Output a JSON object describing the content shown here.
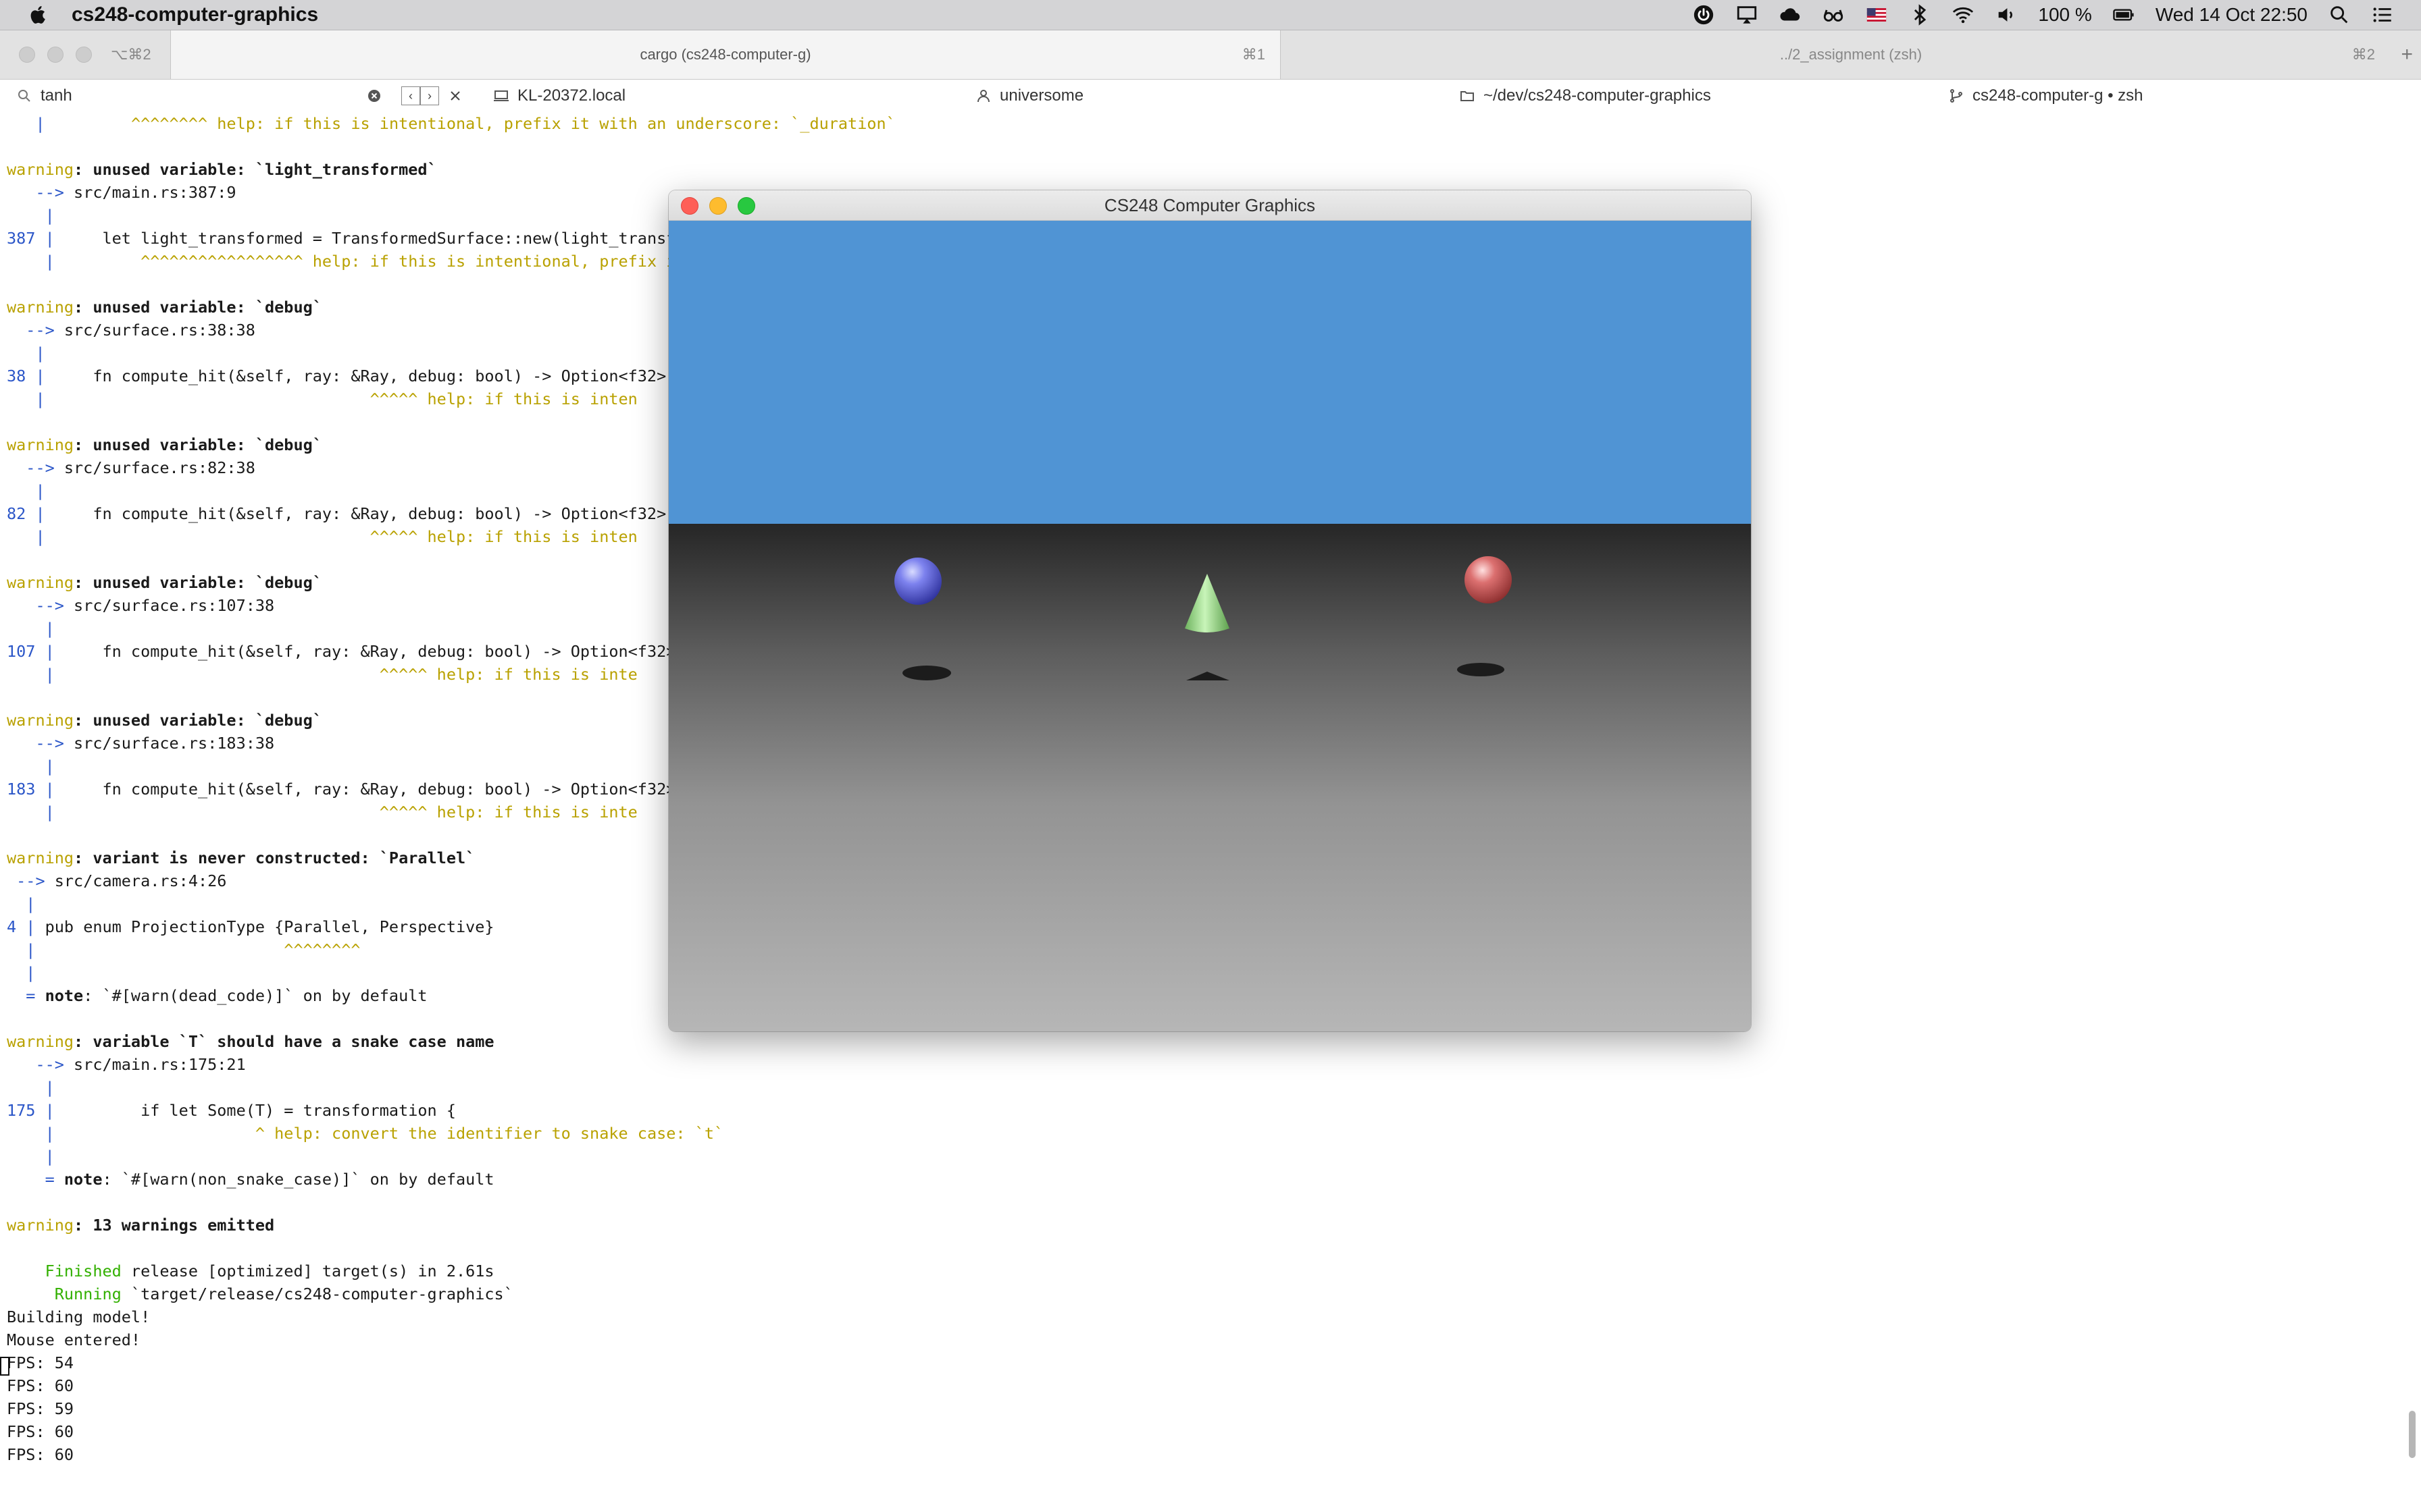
{
  "menubar": {
    "app_name": "cs248-computer-graphics",
    "battery": "100 %",
    "datetime": "Wed 14 Oct  22:50"
  },
  "tabs": {
    "left_shortcut": "⌥⌘2",
    "active_title": "cargo (cs248-computer-g)",
    "active_shortcut": "⌘1",
    "right_title": "../2_assignment (zsh)",
    "right_shortcut": "⌘2",
    "plus": "+"
  },
  "statusbar": {
    "search_value": "tanh",
    "host": "KL-20372.local",
    "user": "universome",
    "path": "~/dev/cs248-computer-graphics",
    "job": "cs248-computer-g • zsh"
  },
  "graphics_window": {
    "title": "CS248 Computer Graphics",
    "colors": {
      "sky": "#5094d4",
      "sphere_blue": "#6f74e6",
      "sphere_red": "#d46666",
      "cone": "#8ed67e"
    }
  },
  "terminal": {
    "lines": [
      [
        [
          "   |         ",
          "blue"
        ],
        [
          "^^^^^^^^ help: if this is intentional, prefix it with an underscore: `_duration`",
          "help"
        ]
      ],
      [],
      [
        [
          "warning",
          "warn"
        ],
        [
          ": unused variable: `light_transformed`",
          "bold"
        ]
      ],
      [
        [
          "   --> ",
          "blue"
        ],
        [
          "src/main.rs:387:9",
          ""
        ]
      ],
      [
        [
          "    |",
          "blue"
        ]
      ],
      [
        [
          "387 |",
          "blue"
        ],
        [
          "     let light_transformed = TransformedSurface::new(light_transf",
          ""
        ]
      ],
      [
        [
          "    |",
          "blue"
        ],
        [
          "         ^^^^^^^^^^^^^^^^^ help: if this is intentional, prefix i",
          "help"
        ]
      ],
      [],
      [
        [
          "warning",
          "warn"
        ],
        [
          ": unused variable: `debug`",
          "bold"
        ]
      ],
      [
        [
          "  --> ",
          "blue"
        ],
        [
          "src/surface.rs:38:38",
          ""
        ]
      ],
      [
        [
          "   |",
          "blue"
        ]
      ],
      [
        [
          "38 |",
          "blue"
        ],
        [
          "     fn compute_hit(&self, ray: &Ray, debug: bool) -> Option<f32>",
          ""
        ]
      ],
      [
        [
          "   |",
          "blue"
        ],
        [
          "                                  ^^^^^ help: if this is inten",
          "help"
        ]
      ],
      [],
      [
        [
          "warning",
          "warn"
        ],
        [
          ": unused variable: `debug`",
          "bold"
        ]
      ],
      [
        [
          "  --> ",
          "blue"
        ],
        [
          "src/surface.rs:82:38",
          ""
        ]
      ],
      [
        [
          "   |",
          "blue"
        ]
      ],
      [
        [
          "82 |",
          "blue"
        ],
        [
          "     fn compute_hit(&self, ray: &Ray, debug: bool) -> Option<f32>",
          ""
        ]
      ],
      [
        [
          "   |",
          "blue"
        ],
        [
          "                                  ^^^^^ help: if this is inten",
          "help"
        ]
      ],
      [],
      [
        [
          "warning",
          "warn"
        ],
        [
          ": unused variable: `debug`",
          "bold"
        ]
      ],
      [
        [
          "   --> ",
          "blue"
        ],
        [
          "src/surface.rs:107:38",
          ""
        ]
      ],
      [
        [
          "    |",
          "blue"
        ]
      ],
      [
        [
          "107 |",
          "blue"
        ],
        [
          "     fn compute_hit(&self, ray: &Ray, debug: bool) -> Option<f32>",
          ""
        ]
      ],
      [
        [
          "    |",
          "blue"
        ],
        [
          "                                  ^^^^^ help: if this is inte",
          "help"
        ]
      ],
      [],
      [
        [
          "warning",
          "warn"
        ],
        [
          ": unused variable: `debug`",
          "bold"
        ]
      ],
      [
        [
          "   --> ",
          "blue"
        ],
        [
          "src/surface.rs:183:38",
          ""
        ]
      ],
      [
        [
          "    |",
          "blue"
        ]
      ],
      [
        [
          "183 |",
          "blue"
        ],
        [
          "     fn compute_hit(&self, ray: &Ray, debug: bool) -> Option<f32>",
          ""
        ]
      ],
      [
        [
          "    |",
          "blue"
        ],
        [
          "                                  ^^^^^ help: if this is inte",
          "help"
        ]
      ],
      [],
      [
        [
          "warning",
          "warn"
        ],
        [
          ": variant is never constructed: `Parallel`",
          "bold"
        ]
      ],
      [
        [
          " --> ",
          "blue"
        ],
        [
          "src/camera.rs:4:26",
          ""
        ]
      ],
      [
        [
          "  |",
          "blue"
        ]
      ],
      [
        [
          "4 |",
          "blue"
        ],
        [
          " pub enum ProjectionType {Parallel, Perspective}",
          ""
        ]
      ],
      [
        [
          "  |",
          "blue"
        ],
        [
          "                          ^^^^^^^^",
          "help"
        ]
      ],
      [
        [
          "  |",
          "blue"
        ]
      ],
      [
        [
          "  = ",
          "blue"
        ],
        [
          "note",
          "bold"
        ],
        [
          ": `#[warn(dead_code)]` on by default",
          ""
        ]
      ],
      [],
      [
        [
          "warning",
          "warn"
        ],
        [
          ": variable `T` should have a snake case name",
          "bold"
        ]
      ],
      [
        [
          "   --> ",
          "blue"
        ],
        [
          "src/main.rs:175:21",
          ""
        ]
      ],
      [
        [
          "    |",
          "blue"
        ]
      ],
      [
        [
          "175 |",
          "blue"
        ],
        [
          "         if let Some(T) = transformation {",
          ""
        ]
      ],
      [
        [
          "    |",
          "blue"
        ],
        [
          "                     ^ help: convert the identifier to snake case: `t`",
          "help"
        ]
      ],
      [
        [
          "    |",
          "blue"
        ]
      ],
      [
        [
          "    = ",
          "blue"
        ],
        [
          "note",
          "bold"
        ],
        [
          ": `#[warn(non_snake_case)]` on by default",
          ""
        ]
      ],
      [],
      [
        [
          "warning",
          "warn"
        ],
        [
          ": 13 warnings emitted",
          "bold"
        ]
      ],
      [],
      [
        [
          "    Finished",
          "green"
        ],
        [
          " release [optimized] target(s) in 2.61s",
          ""
        ]
      ],
      [
        [
          "     Running",
          "green"
        ],
        [
          " `target/release/cs248-computer-graphics`",
          ""
        ]
      ],
      [
        [
          "Building model!",
          ""
        ]
      ],
      [
        [
          "Mouse entered!",
          ""
        ]
      ],
      [
        [
          "FPS: 54",
          ""
        ]
      ],
      [
        [
          "FPS: 60",
          ""
        ]
      ],
      [
        [
          "FPS: 59",
          ""
        ]
      ],
      [
        [
          "FPS: 60",
          ""
        ]
      ],
      [
        [
          "FPS: 60",
          ""
        ]
      ]
    ]
  }
}
